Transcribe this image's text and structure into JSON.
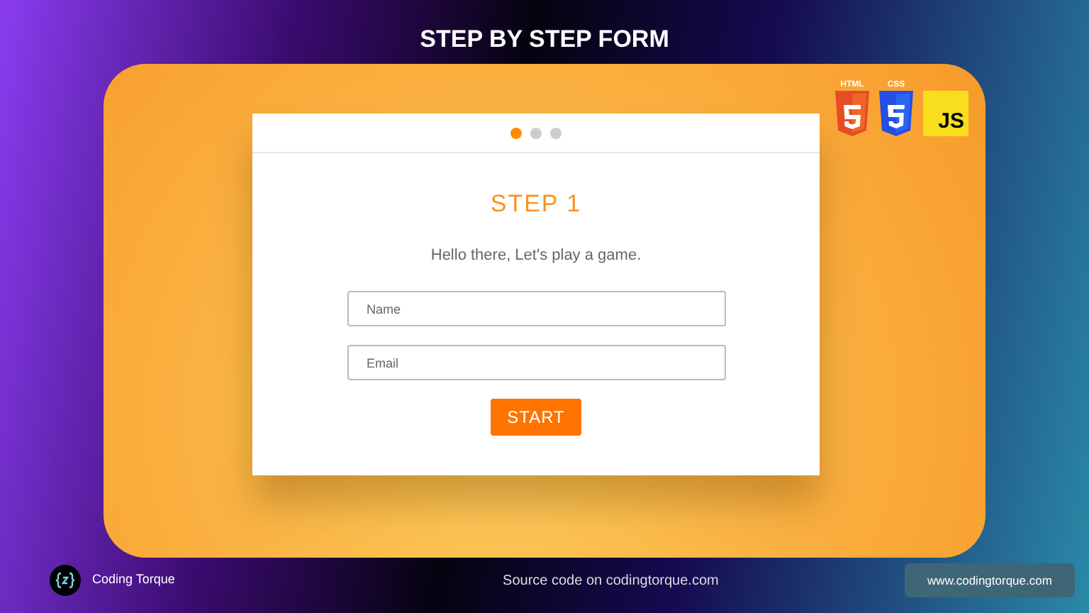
{
  "title": "STEP BY STEP FORM",
  "logos": [
    {
      "kind": "html",
      "label": "HTML"
    },
    {
      "kind": "css",
      "label": "CSS"
    },
    {
      "kind": "js",
      "label": "JS"
    }
  ],
  "form": {
    "steps": [
      {
        "selected": true
      },
      {
        "selected": false
      },
      {
        "selected": false
      }
    ],
    "heading": "STEP 1",
    "subtitle": "Hello there, Let's play a game.",
    "fields": [
      {
        "placeholder": "Name"
      },
      {
        "placeholder": "Email"
      }
    ],
    "button": "START"
  },
  "footer": {
    "brand": "Coding Torque",
    "source": "Source code on codingtorque.com",
    "website": "www.codingtorque.com"
  }
}
